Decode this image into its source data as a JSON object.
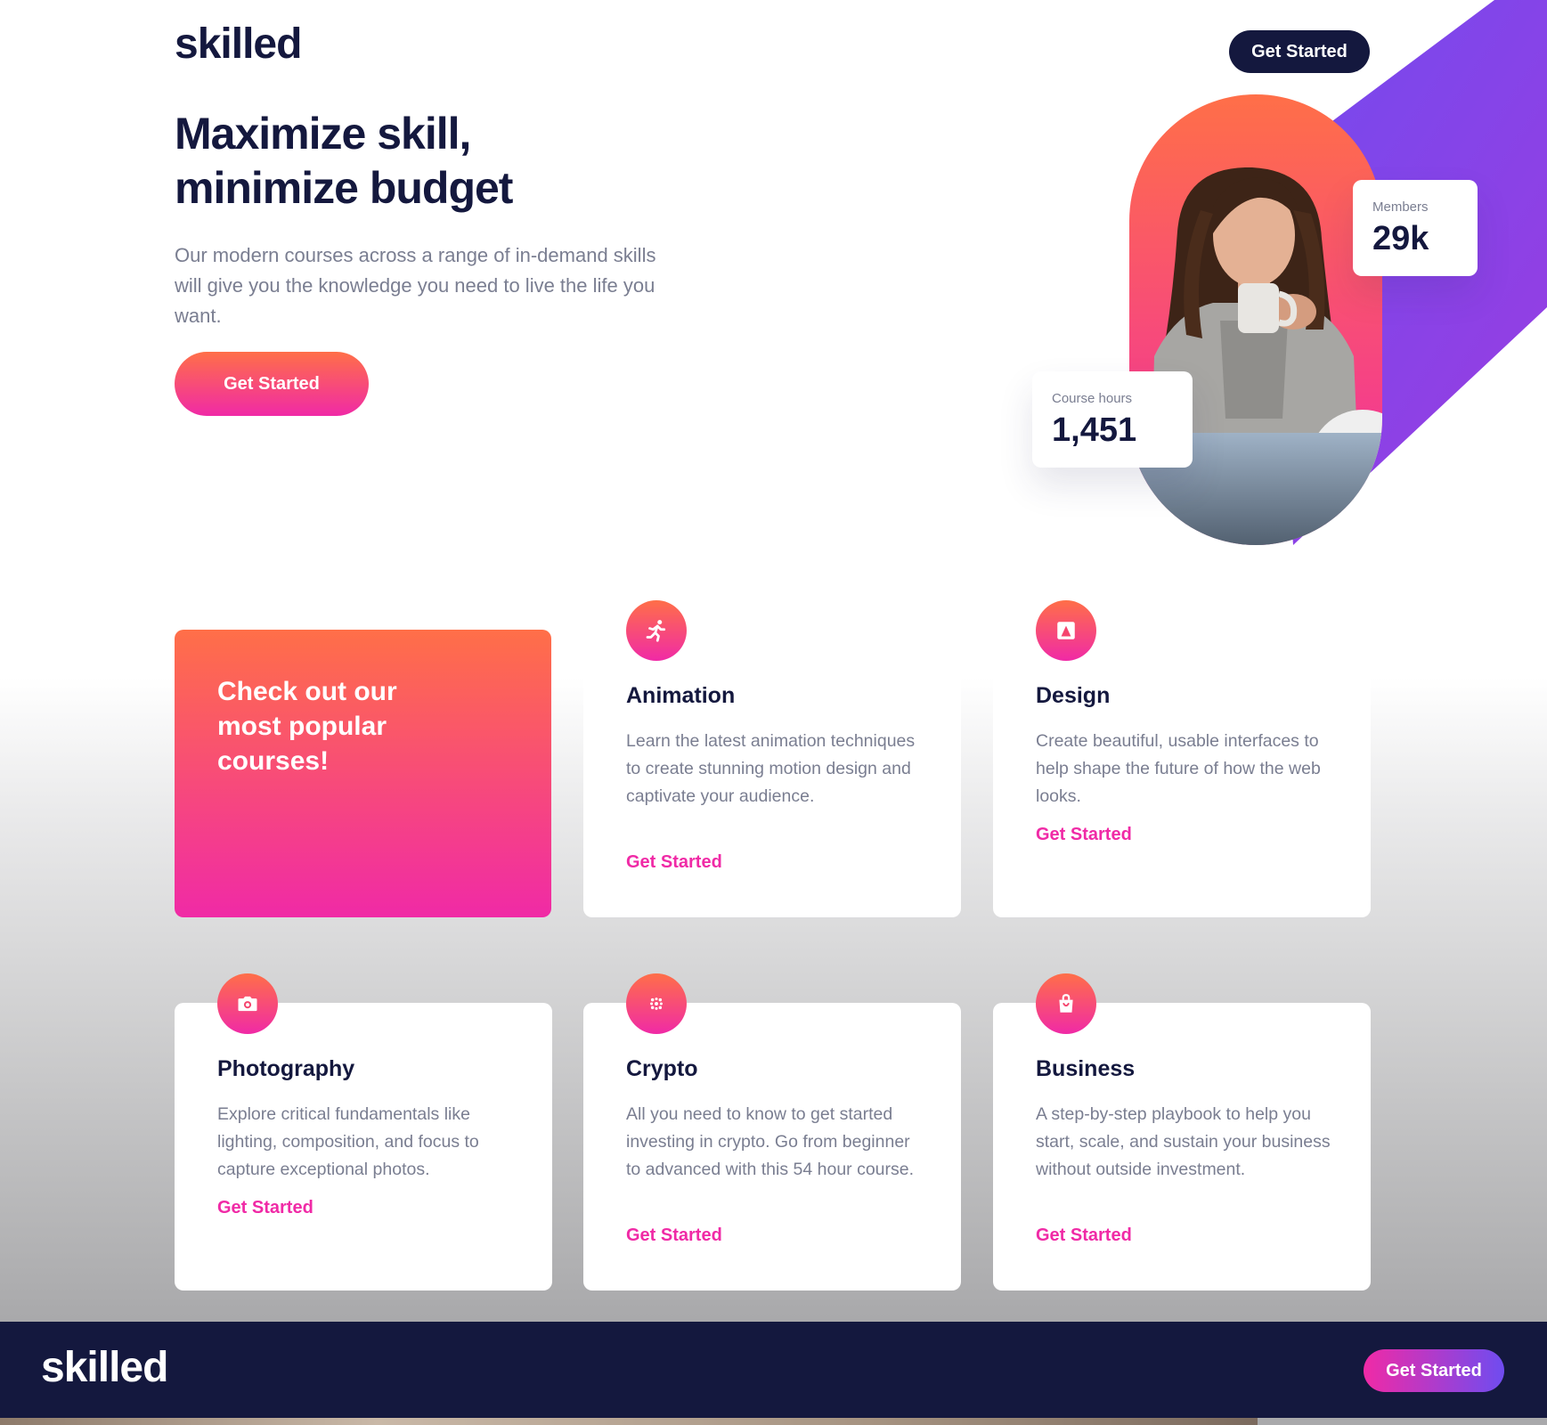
{
  "brand": {
    "name": "skilled"
  },
  "header": {
    "cta_label": "Get Started"
  },
  "hero": {
    "title": "Maximize skill, minimize budget",
    "description": "Our modern courses across a range of in-demand skills will give you the knowledge you need to live the life you want.",
    "cta_label": "Get Started"
  },
  "stats": {
    "members": {
      "label": "Members",
      "value": "29k"
    },
    "course_hours": {
      "label": "Course hours",
      "value": "1,451"
    }
  },
  "promo": {
    "text": "Check out our most popular courses!"
  },
  "courses": [
    {
      "title": "Animation",
      "icon": "running-figure-icon",
      "description": "Learn the latest animation techniques to create stunning motion design and captivate your audience.",
      "link_label": "Get Started"
    },
    {
      "title": "Design",
      "icon": "image-frame-icon",
      "description": "Create beautiful, usable interfaces to help shape the future of how the web looks.",
      "link_label": "Get Started"
    },
    {
      "title": "Photography",
      "icon": "camera-icon",
      "description": "Explore critical fundamentals like lighting, composition, and focus to capture exceptional photos.",
      "link_label": "Get Started"
    },
    {
      "title": "Crypto",
      "icon": "dot-grid-icon",
      "description": "All you need to know to get started investing in crypto. Go from beginner to advanced with this 54 hour course.",
      "link_label": "Get Started"
    },
    {
      "title": "Business",
      "icon": "shopping-bag-icon",
      "description": "A step-by-step playbook to help you start, scale, and sustain your business without outside investment.",
      "link_label": "Get Started"
    }
  ],
  "footer": {
    "brand": "skilled",
    "cta_label": "Get Started"
  },
  "colors": {
    "navy": "#14183e",
    "gradient_start": "#ff6f48",
    "gradient_end": "#f02aa6",
    "purple": "#6f4cf0",
    "body_text": "#7a7e91"
  }
}
